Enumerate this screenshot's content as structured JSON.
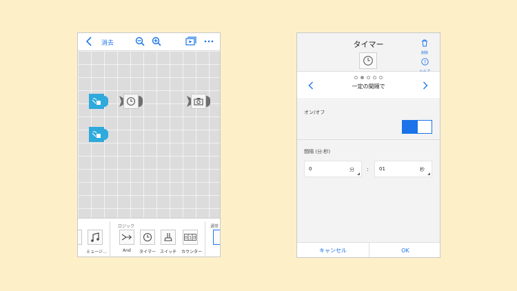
{
  "left_app": {
    "toolbar": {
      "delete_label": "消去"
    },
    "palette": {
      "logic_title": "ロジック",
      "partial_title": "通常",
      "items": [
        {
          "label": "ミュージ…",
          "icon": "music-note-icon"
        },
        {
          "label": "And",
          "icon": "and-gate-icon"
        },
        {
          "label": "タイマー",
          "icon": "timer-clock-icon"
        },
        {
          "label": "スイッチ",
          "icon": "toggle-switch-icon"
        },
        {
          "label": "カウンター",
          "icon": "counter-icon"
        }
      ]
    }
  },
  "right_app": {
    "title": "タイマー",
    "delete_label": "削除",
    "help_label": "ヘルプ",
    "mode_label": "一定の間隔で",
    "page_count": 5,
    "active_page": 1,
    "onoff_label": "オン/オフ",
    "toggle_on": true,
    "interval_label": "間隔 (分:秒)",
    "minutes_value": "0",
    "minutes_unit": "分",
    "colon": ":",
    "seconds_value": "01",
    "seconds_unit": "秒",
    "cancel_label": "キャンセル",
    "ok_label": "OK"
  },
  "colors": {
    "accent": "#1a73e8",
    "block_blue": "#2eaadc",
    "background": "#fdf0c9"
  }
}
